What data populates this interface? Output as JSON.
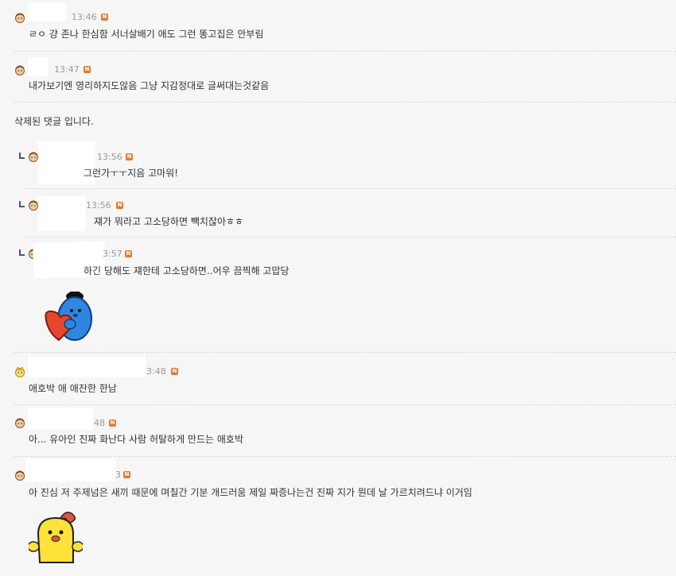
{
  "comments": [
    {
      "time": "13:46",
      "badge": "N",
      "text": "ㄹㅇ 걍 존나 한심함 서너살배기 애도 그런 똥고집은 안부림"
    },
    {
      "time": "13:47",
      "badge": "N",
      "text": "내가보기엔 영리하지도않음 그냥 지감정대로 글써대는것같음"
    },
    {
      "text": "삭제된 댓글 입니다."
    },
    {
      "time": "13:56",
      "badge": "N",
      "text": "그런가ㅜㅜ지음 고마워!"
    },
    {
      "time": "13:56",
      "badge": "N",
      "text": "쟤가 뭐라고 고소당하면 빽치잖아ㅎㅎ"
    },
    {
      "time": "3:57",
      "badge": "N",
      "text": "하긴 당해도 쟤한테 고소당하면..어우 끔찍해 고맙당"
    },
    {
      "time": "3:48",
      "badge": "N",
      "text": "애호박 애 애잔한 한남"
    },
    {
      "time": "48",
      "badge": "N",
      "text": "아... 유아인 진짜 화난다 사람 허탈하게 만드는 애호박"
    },
    {
      "time": "3",
      "badge": "N",
      "text": "아 진심 저 주제넘은 새끼 때문에 며칠간 기분 개드러움 제일 짜증나는건 진짜 지가 뭔데 날 가르치려드냐 이거임"
    }
  ],
  "colors": {
    "badge": "#e07a2e",
    "background": "#f6f6f6",
    "mask": "#ffffff"
  },
  "stickers": [
    "blue-character-heart-sticker",
    "yellow-chick-sticker"
  ]
}
